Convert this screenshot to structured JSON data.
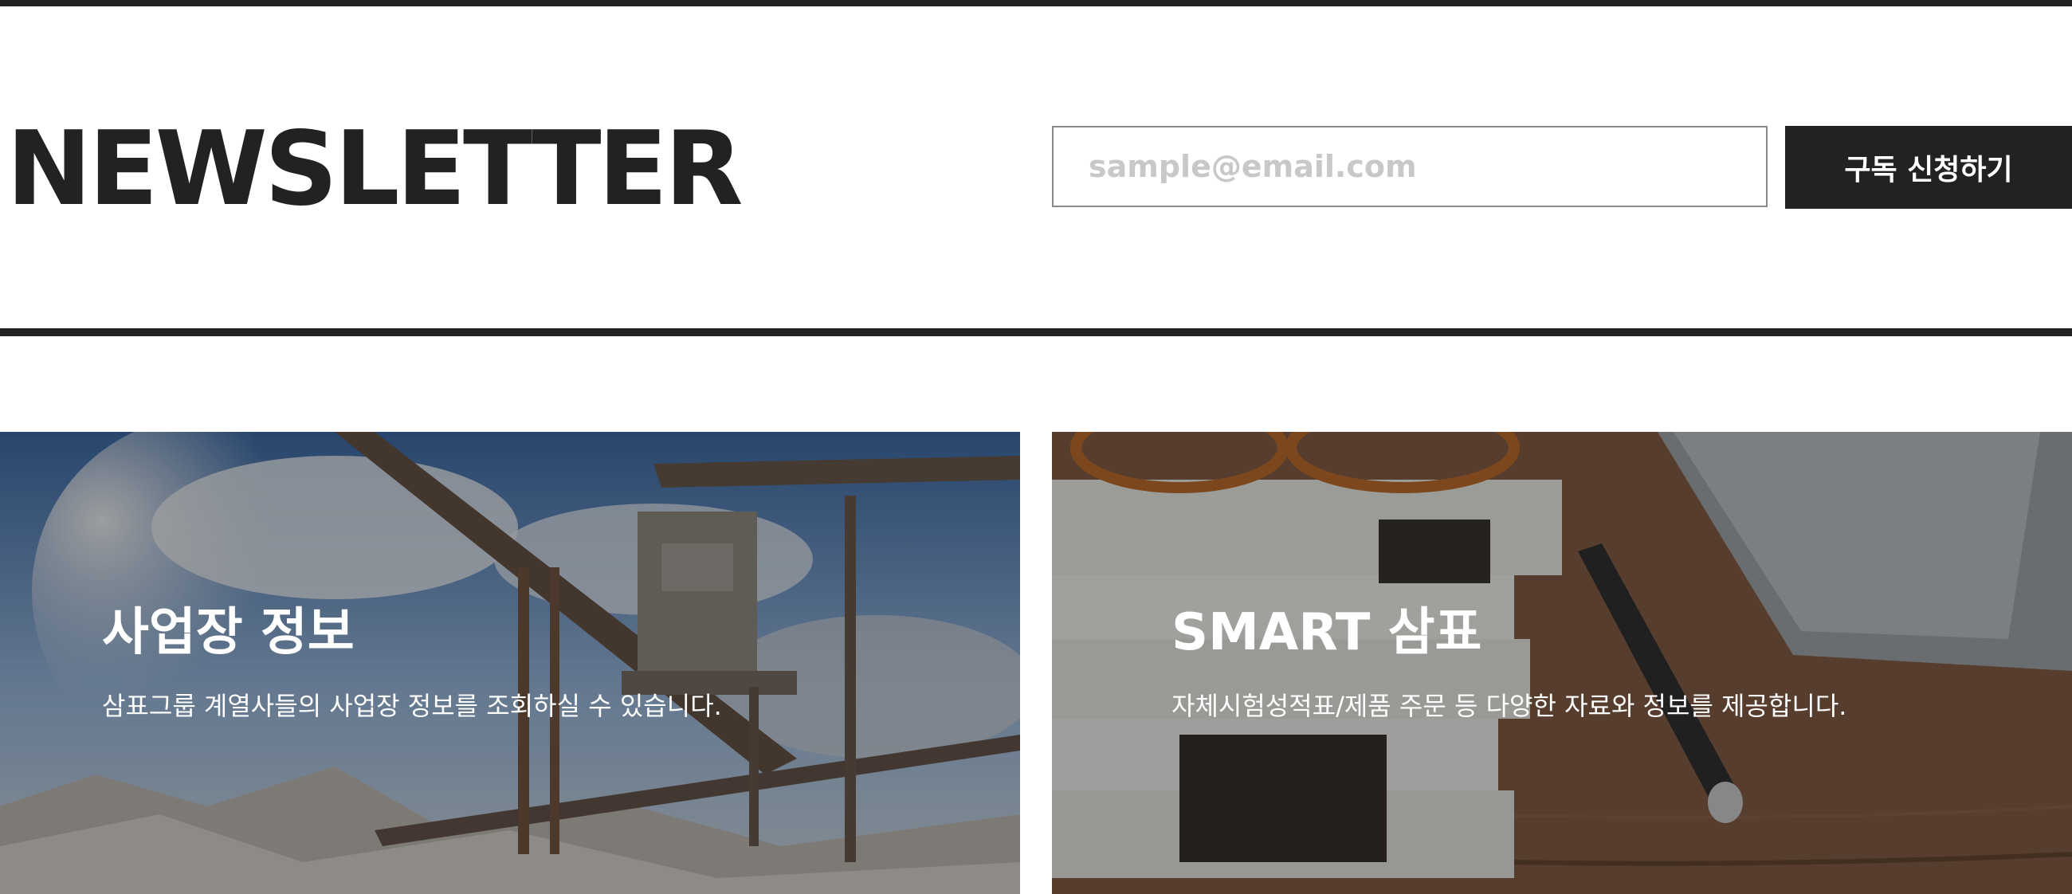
{
  "newsletter": {
    "title": "NEWSLETTER",
    "email_placeholder": "sample@email.com",
    "subscribe_label": "구독 신청하기"
  },
  "cards": [
    {
      "title": "사업장 정보",
      "description": "삼표그룹 계열사들의 사업장 정보를 조회하실 수 있습니다."
    },
    {
      "title": "SMART 삼표",
      "description": "자체시험성적표/제품 주문 등 다양한 자료와 정보를 제공합니다."
    }
  ]
}
